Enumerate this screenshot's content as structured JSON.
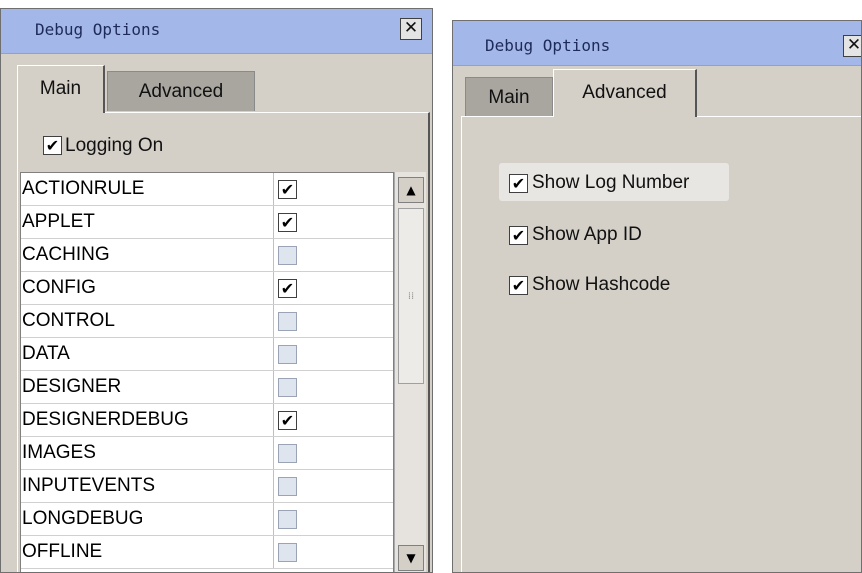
{
  "colors": {
    "titlebar": "#a3b8e8",
    "window_bg": "#d4d0c8",
    "inactive_tab": "#a9a6a0"
  },
  "left_window": {
    "title": "Debug Options",
    "close_glyph": "✕",
    "tabs": [
      "Main",
      "Advanced"
    ],
    "active_tab": "Main",
    "logging_on": {
      "label": "Logging On",
      "checked": true
    },
    "items": [
      {
        "name": "ACTIONRULE",
        "checked": true
      },
      {
        "name": "APPLET",
        "checked": true
      },
      {
        "name": "CACHING",
        "checked": false
      },
      {
        "name": "CONFIG",
        "checked": true
      },
      {
        "name": "CONTROL",
        "checked": false
      },
      {
        "name": "DATA",
        "checked": false
      },
      {
        "name": "DESIGNER",
        "checked": false
      },
      {
        "name": "DESIGNERDEBUG",
        "checked": true
      },
      {
        "name": "IMAGES",
        "checked": false
      },
      {
        "name": "INPUTEVENTS",
        "checked": false
      },
      {
        "name": "LONGDEBUG",
        "checked": false
      },
      {
        "name": "OFFLINE",
        "checked": false
      }
    ]
  },
  "right_window": {
    "title": "Debug Options",
    "close_glyph": "✕",
    "tabs": [
      "Main",
      "Advanced"
    ],
    "active_tab": "Advanced",
    "options": [
      {
        "label": "Show Log Number",
        "checked": true
      },
      {
        "label": "Show App ID",
        "checked": true
      },
      {
        "label": "Show Hashcode",
        "checked": true
      }
    ]
  }
}
